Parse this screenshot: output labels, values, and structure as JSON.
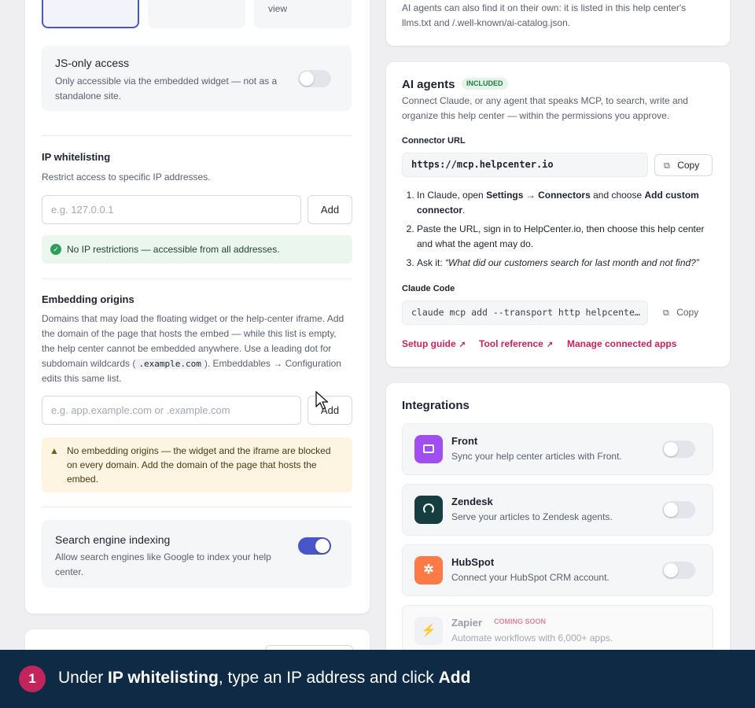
{
  "left": {
    "view_option_label": "view",
    "js_only": {
      "title": "JS-only access",
      "desc": "Only accessible via the embedded widget — not as a standalone site.",
      "enabled": false
    },
    "ip": {
      "title": "IP whitelisting",
      "desc": "Restrict access to specific IP addresses.",
      "placeholder": "e.g. 127.0.0.1",
      "add_label": "Add",
      "status": "No IP restrictions — accessible from all addresses."
    },
    "embedding": {
      "title": "Embedding origins",
      "desc_part1": "Domains that may load the floating widget or the help-center iframe. Add the domain of the page that hosts the embed — while this list is empty, the help center cannot be embedded anywhere. Use a leading dot for subdomain wildcards (",
      "desc_code": ".example.com",
      "desc_part2": "). Embeddables → Configuration edits this same list.",
      "placeholder": "e.g. app.example.com or .example.com",
      "add_label": "Add",
      "warning": "No embedding origins — the widget and the iframe are blocked on every domain. Add the domain of the page that hosts the embed."
    },
    "seo": {
      "title": "Search engine indexing",
      "desc": "Allow search engines like Google to index your help center.",
      "enabled": true
    }
  },
  "right": {
    "top_text": "AI agents can also find it on their own: it is listed in this help center's llms.txt and /.well-known/ai-catalog.json.",
    "ai": {
      "title": "AI agents",
      "badge": "INCLUDED",
      "desc": "Connect Claude, or any agent that speaks MCP, to search, write and organize this help center — within the permissions you approve.",
      "connector_label": "Connector URL",
      "connector_url": "https://mcp.helpcenter.io",
      "copy_label": "Copy",
      "step1_pre": "In Claude, open ",
      "step1_b1": "Settings → Connectors",
      "step1_mid": " and choose ",
      "step1_b2": "Add custom connector",
      "step1_end": ".",
      "step2": "Paste the URL, sign in to HelpCenter.io, then choose this help center and what the agent may do.",
      "step3_pre": "Ask it: ",
      "step3_quote": "“What did our customers search for last month and not find?”",
      "claude_code_label": "Claude Code",
      "claude_code_cmd": "claude mcp add --transport http helpcente…",
      "copy2_label": "Copy",
      "links": [
        "Setup guide",
        "Tool reference",
        "Manage connected apps"
      ]
    },
    "integrations": {
      "title": "Integrations",
      "items": [
        {
          "name": "Front",
          "desc": "Sync your help center articles with Front.",
          "color": "#a14ef0",
          "icon": "inbox-icon"
        },
        {
          "name": "Zendesk",
          "desc": "Serve your articles to Zendesk agents.",
          "color": "#163d3f",
          "icon": "headset-icon"
        },
        {
          "name": "HubSpot",
          "desc": "Connect your HubSpot CRM account.",
          "color": "#ff7a45",
          "icon": "hubspot-icon"
        },
        {
          "name": "Zapier",
          "badge": "COMING SOON",
          "desc": "Automate workflows with 6,000+ apps.",
          "icon": "bolt-icon"
        }
      ]
    }
  },
  "footer": {
    "step_number": "1",
    "text_pre": "Under ",
    "text_bold1": "IP whitelisting",
    "text_mid": ", type an IP address and click ",
    "text_bold2": "Add"
  }
}
